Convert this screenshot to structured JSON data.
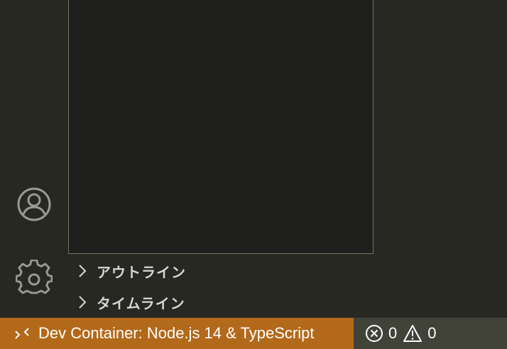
{
  "activity_bar": {
    "icons": [
      {
        "name": "account-icon"
      },
      {
        "name": "gear-icon"
      }
    ]
  },
  "sidebar": {
    "sections": [
      {
        "title": "アウトライン",
        "collapsed": true
      },
      {
        "title": "タイムライン",
        "collapsed": true
      }
    ]
  },
  "status_bar": {
    "remote_label": "Dev Container: Node.js 14 & TypeScript",
    "remote_color": "#b3691a",
    "errors": "0",
    "warnings": "0"
  },
  "colors": {
    "background": "#272822",
    "editor": "#1e1f1c",
    "status_bar": "#414339",
    "border": "#75715e"
  }
}
